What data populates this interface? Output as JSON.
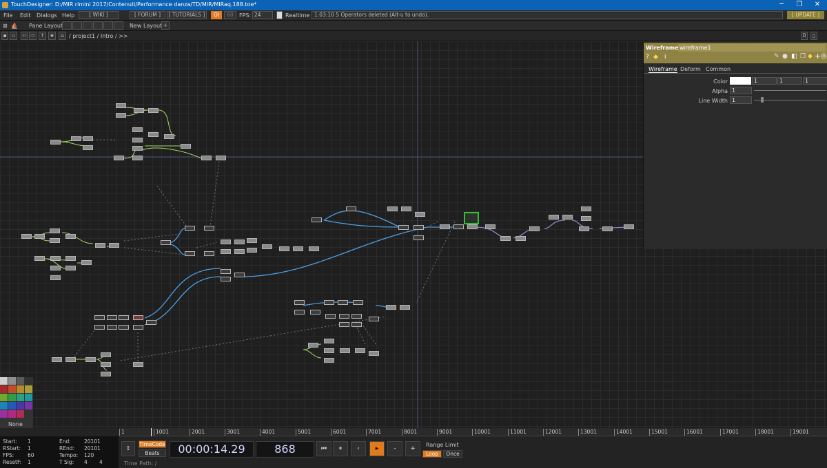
{
  "window": {
    "title": "TouchDesigner: D:/MIR rimini 2017/Contenuti/Performance danza/TD/MIR/MIRaq.188.toe*",
    "min": "─",
    "max": "❐",
    "close": "✕"
  },
  "menu": {
    "items": [
      "File",
      "Edit",
      "Dialogs",
      "Help"
    ],
    "wiki": "[ WIKI ]",
    "forum": "[ FORUM ]",
    "tutorials": "[ TUTORIALS ]",
    "oi": "OI",
    "num60": "60",
    "fps_label": "FPS:",
    "fps": "24",
    "realtime": "Realtime",
    "status": "1:03:10 5 Operators deleted (Alt-u to undo).",
    "update": "[ UPDATE ]"
  },
  "panebar": {
    "pane_layout": "Pane Layout",
    "new_layout": "New Layout",
    "plus": "+",
    "zero": "0"
  },
  "pathbar": {
    "path": "/ project1 / Intro / >>"
  },
  "params": {
    "op_type": "Wireframe",
    "op_name": "wireframe1",
    "tabs": [
      "Wireframe",
      "Deform",
      "Common"
    ],
    "color_label": "Color",
    "color_vals": [
      "1",
      "1",
      "1"
    ],
    "alpha_label": "Alpha",
    "alpha": "1",
    "linewidth_label": "Line Width",
    "linewidth": "1",
    "tab_active_color": "#ffffff"
  },
  "palette": {
    "none": "None"
  },
  "timeline": {
    "ticks": [
      "1",
      "1001",
      "2001",
      "3001",
      "4001",
      "5001",
      "6001",
      "7001",
      "8001",
      "9001",
      "10001",
      "11001",
      "12001",
      "13001",
      "14001",
      "15001",
      "16001",
      "17001",
      "18001",
      "19001"
    ],
    "start_label": "Start:",
    "start": "1",
    "end_label": "End:",
    "end": "20101",
    "rstart_label": "RStart:",
    "rstart": "1",
    "rend_label": "REnd:",
    "rend": "20101",
    "fps_label": "FPS:",
    "fps": "60",
    "tempo_label": "Tempo:",
    "tempo": "120",
    "resetf_label": "ResetF:",
    "resetf": "1",
    "tsig_label": "T Sig:",
    "tsig_a": "4",
    "tsig_b": "4",
    "timecode": "TimeCode",
    "beats": "Beats",
    "time": "00:00:14.29",
    "frame": "868",
    "range_limit": "Range Limit",
    "loop": "Loop",
    "once": "Once",
    "time_path": "Time Path: /"
  }
}
